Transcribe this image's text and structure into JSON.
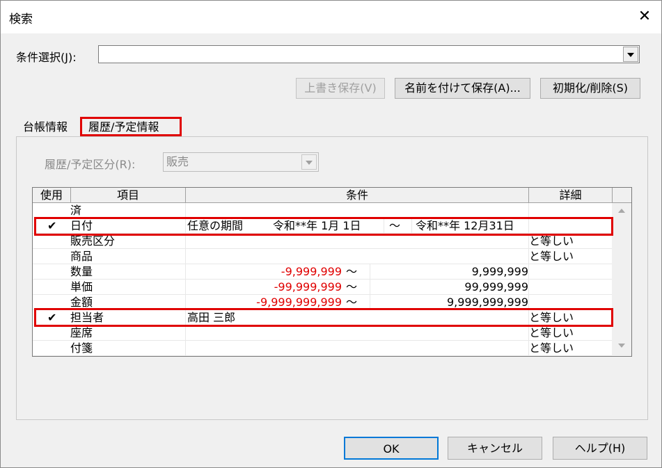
{
  "window": {
    "title": "検索",
    "close_glyph": "✕"
  },
  "condition": {
    "label": "条件選択(J):",
    "value": ""
  },
  "buttons": {
    "overwrite": "上書き保存(V)",
    "save_as": "名前を付けて保存(A)...",
    "reset": "初期化/削除(S)",
    "ok": "OK",
    "cancel": "キャンセル",
    "help": "ヘルプ(H)"
  },
  "tabs": [
    {
      "label": "台帳情報",
      "selected": false
    },
    {
      "label": "履歴/予定情報",
      "selected": true
    }
  ],
  "category": {
    "label": "履歴/予定区分(R):",
    "value": "販売"
  },
  "grid": {
    "headers": [
      "使用",
      "項目",
      "条件",
      "詳細"
    ],
    "rows": [
      {
        "check": "",
        "item": "済",
        "cond": "",
        "range_from": "",
        "tilde": "",
        "range_to": "",
        "detail": ""
      },
      {
        "check": "✔",
        "item": "日付",
        "cond": "任意の期間",
        "range_from": "令和**年 1月 1日",
        "tilde": "～",
        "range_to": "令和**年 12月31日",
        "detail": ""
      },
      {
        "check": "",
        "item": "販売区分",
        "cond": "",
        "range_from": "",
        "tilde": "",
        "range_to": "",
        "detail": "と等しい"
      },
      {
        "check": "",
        "item": "商品",
        "cond": "",
        "range_from": "",
        "tilde": "",
        "range_to": "",
        "detail": "と等しい"
      },
      {
        "check": "",
        "item": "数量",
        "cond": "",
        "range_from": "-9,999,999",
        "tilde": "～",
        "range_to": "9,999,999",
        "detail": ""
      },
      {
        "check": "",
        "item": "単価",
        "cond": "",
        "range_from": "-99,999,999",
        "tilde": "～",
        "range_to": "99,999,999",
        "detail": ""
      },
      {
        "check": "",
        "item": "金額",
        "cond": "",
        "range_from": "-9,999,999,999",
        "tilde": "～",
        "range_to": "9,999,999,999",
        "detail": ""
      },
      {
        "check": "✔",
        "item": "担当者",
        "cond": "高田 三郎",
        "range_from": "",
        "tilde": "",
        "range_to": "",
        "detail": "と等しい"
      },
      {
        "check": "",
        "item": "座席",
        "cond": "",
        "range_from": "",
        "tilde": "",
        "range_to": "",
        "detail": "と等しい"
      },
      {
        "check": "",
        "item": "付箋",
        "cond": "",
        "range_from": "",
        "tilde": "",
        "range_to": "",
        "detail": "と等しい"
      }
    ]
  },
  "colors": {
    "highlight": "#e00000",
    "negative_value": "#e00000"
  },
  "icons": {
    "close": "close-icon",
    "dropdown": "chevron-down-icon",
    "check": "checkmark-icon"
  }
}
